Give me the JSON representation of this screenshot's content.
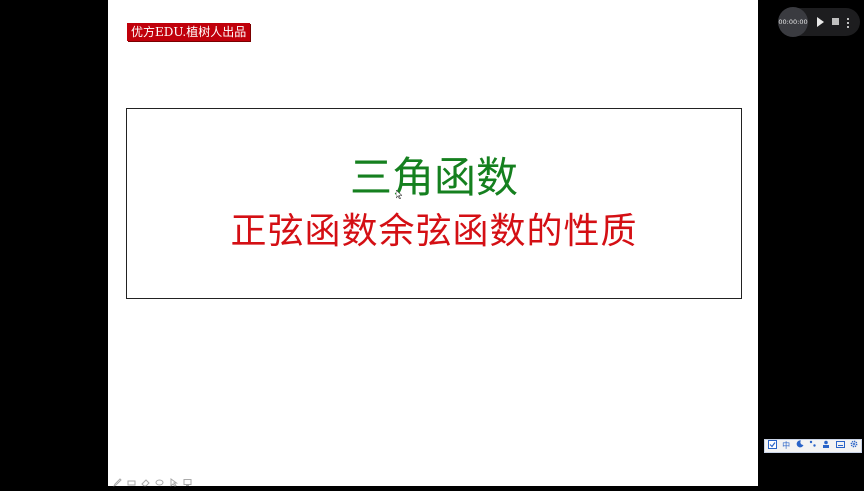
{
  "slide": {
    "brand_label": "优方EDU.植树人出品",
    "title_main": "三角函数",
    "title_sub": "正弦函数余弦函数的性质"
  },
  "player": {
    "time": "00:00:00"
  },
  "ime_toolbar": {
    "lang_label": "中"
  },
  "colors": {
    "brand_bg": "#c0000b",
    "title_main": "#15801f",
    "title_sub": "#d40f14"
  }
}
